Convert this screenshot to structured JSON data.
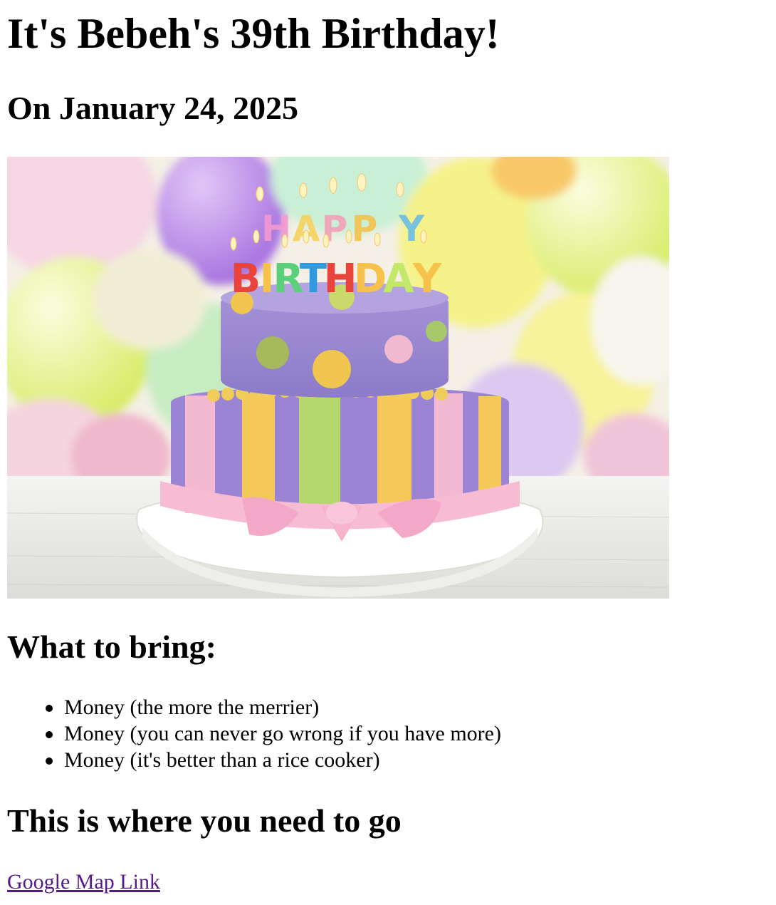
{
  "page": {
    "title": "It's Bebeh's 39th Birthday!",
    "date_heading": "On January 24, 2025",
    "image": {
      "subject": "birthday cake with HAPPY BIRTHDAY candles and balloons",
      "candle_text_top": "HAPPY",
      "candle_text_bottom": "BIRTHDAY"
    },
    "bring_heading": "What to bring:",
    "bring_items": [
      "Money (the more the merrier)",
      "Money (you can never go wrong if you have more)",
      "Money (it's better than a rice cooker)"
    ],
    "where_heading": "This is where you need to go",
    "map_link_label": "Google Map Link"
  },
  "colors": {
    "link_visited": "#551a8b",
    "text": "#000000",
    "background": "#ffffff"
  }
}
